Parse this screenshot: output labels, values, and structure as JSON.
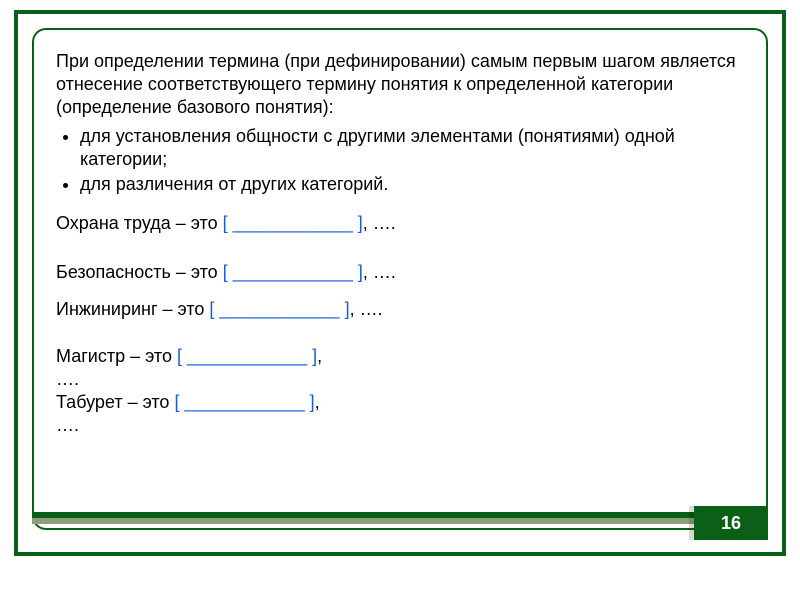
{
  "intro": "При определении термина (при дефинировании) самым первым шагом является отнесение соответствующего термину понятия к определенной категории (определение базового понятия):",
  "bullets": [
    "для установления общности с другими элементами (понятиями) одной категории;",
    "для различения от других категорий."
  ],
  "definitions": [
    {
      "term": "Охрана труда",
      "suffix_text": ", …."
    },
    {
      "term": "Безопасность",
      "suffix_text": ", …."
    },
    {
      "term": "Инжиниринг",
      "suffix_text": ", …."
    },
    {
      "term": "Магистр",
      "suffix_text": ","
    },
    {
      "term": "Табурет",
      "suffix_text": ","
    }
  ],
  "blank": {
    "connector": " – это ",
    "open": "[ ",
    "line": "____________",
    "close": "  ]"
  },
  "ellipsis_line": "….",
  "page_number": "16",
  "colors": {
    "frame": "#0b5f16",
    "accent_light": "#8ea079",
    "blank": "#1a5bd8"
  }
}
